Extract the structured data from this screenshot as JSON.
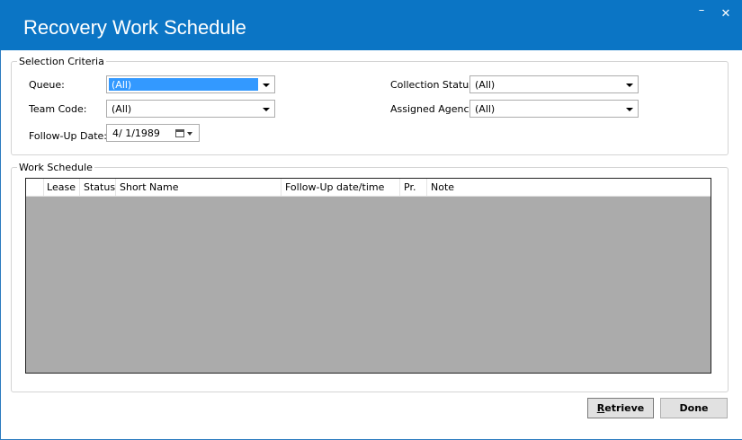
{
  "window": {
    "title": "Recovery Work Schedule",
    "minimize_glyph": "–",
    "close_glyph": "✕"
  },
  "selection": {
    "legend": "Selection Criteria",
    "queue_label": "Queue:",
    "queue_value": "(All)",
    "team_label": "Team Code:",
    "team_value": "(All)",
    "followup_label": "Follow-Up Date:",
    "followup_value": "4/  1/1989",
    "collection_label": "Collection Status:",
    "collection_value": "(All)",
    "agency_label": "Assigned Agency:",
    "agency_value": "(All)"
  },
  "work_schedule": {
    "legend": "Work Schedule",
    "columns": [
      "Lease",
      "Status",
      "Short Name",
      "Follow-Up date/time",
      "Pr.",
      "Note"
    ]
  },
  "buttons": {
    "retrieve": "Retrieve",
    "done": "Done"
  },
  "icons": {
    "calendar": "calendar-icon",
    "dropdown": "chevron-down-icon"
  }
}
